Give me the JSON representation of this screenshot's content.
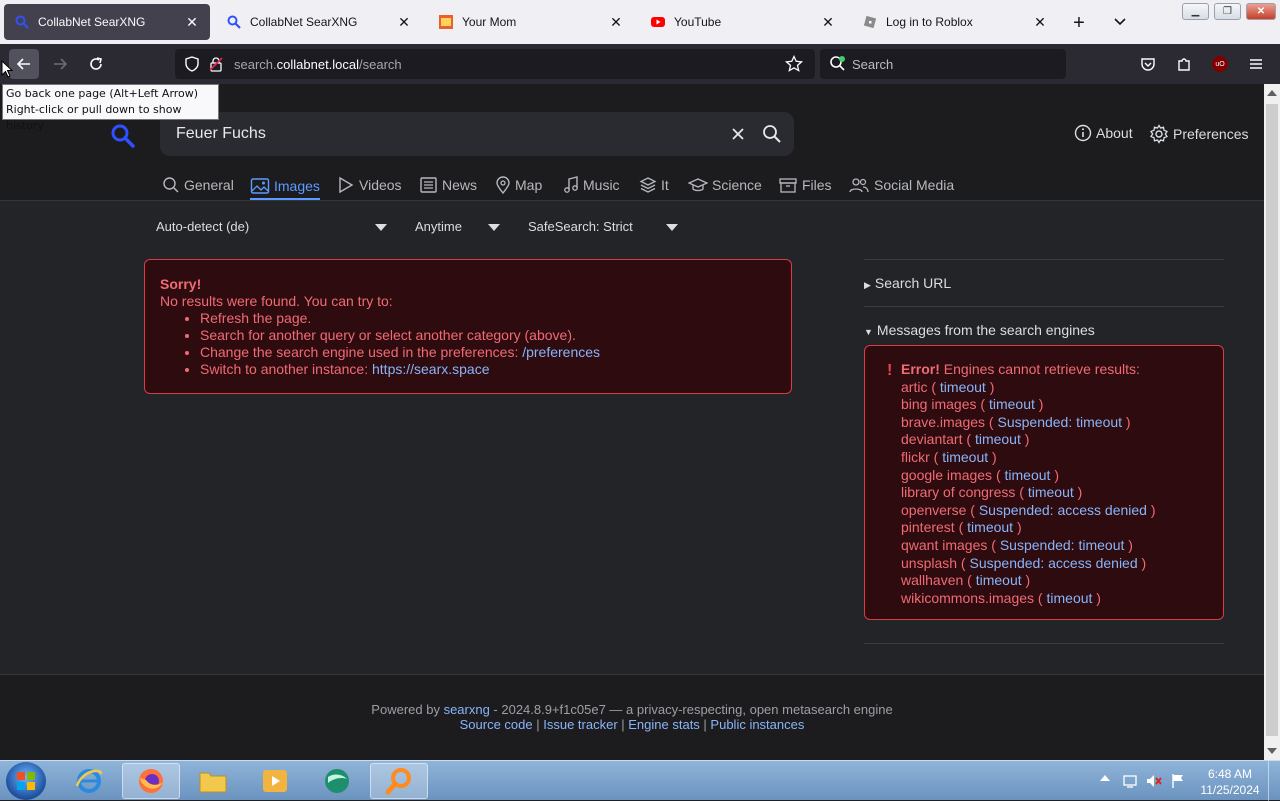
{
  "tabs": [
    {
      "title": "CollabNet SearXNG",
      "active": true,
      "icon": "search-icon"
    },
    {
      "title": "CollabNet SearXNG",
      "active": false,
      "icon": "search-icon"
    },
    {
      "title": "Your Mom",
      "active": false,
      "icon": "image-favicon-icon"
    },
    {
      "title": "YouTube",
      "active": false,
      "icon": "youtube-icon"
    },
    {
      "title": "Log in to Roblox",
      "active": false,
      "icon": "roblox-icon"
    }
  ],
  "url": {
    "prefix": "search.",
    "domain": "collabnet.local",
    "path": "/search"
  },
  "browser_search_placeholder": "Search",
  "tooltip": {
    "line1": "Go back one page (Alt+Left Arrow)",
    "line2": "Right-click or pull down to show history"
  },
  "query": "Feuer Fuchs",
  "header_links": {
    "about": "About",
    "preferences": "Preferences"
  },
  "categories": [
    "General",
    "Images",
    "Videos",
    "News",
    "Map",
    "Music",
    "It",
    "Science",
    "Files",
    "Social Media"
  ],
  "active_category": "Images",
  "filters": {
    "language": "Auto-detect (de)",
    "time": "Anytime",
    "safesearch": "SafeSearch: Strict"
  },
  "sorry": {
    "title": "Sorry!",
    "intro": "No results were found. You can try to:",
    "items": [
      {
        "text": "Refresh the page.",
        "link": ""
      },
      {
        "text": "Search for another query or select another category (above).",
        "link": ""
      },
      {
        "text": "Change the search engine used in the preferences: ",
        "link": "/preferences"
      },
      {
        "text": "Switch to another instance: ",
        "link": "https://searx.space"
      }
    ]
  },
  "sidebar": {
    "search_url": "Search URL",
    "messages_title": "Messages from the search engines",
    "error_label": "Error!",
    "error_text": "Engines cannot retrieve results:",
    "engines": [
      {
        "name": "artic",
        "reason": "timeout"
      },
      {
        "name": "bing images",
        "reason": "timeout"
      },
      {
        "name": "brave.images",
        "reason": "Suspended: timeout"
      },
      {
        "name": "deviantart",
        "reason": "timeout"
      },
      {
        "name": "flickr",
        "reason": "timeout"
      },
      {
        "name": "google images",
        "reason": "timeout"
      },
      {
        "name": "library of congress",
        "reason": "timeout"
      },
      {
        "name": "openverse",
        "reason": "Suspended: access denied"
      },
      {
        "name": "pinterest",
        "reason": "timeout"
      },
      {
        "name": "qwant images",
        "reason": "Suspended: timeout"
      },
      {
        "name": "unsplash",
        "reason": "Suspended: access denied"
      },
      {
        "name": "wallhaven",
        "reason": "timeout"
      },
      {
        "name": "wikicommons.images",
        "reason": "timeout"
      }
    ]
  },
  "footer": {
    "powered_by": "Powered by ",
    "searxng": "searxng",
    "version": " - 2024.8.9+f1c05e7 — a privacy-respecting, open metasearch engine",
    "links": [
      "Source code",
      "Issue tracker",
      "Engine stats",
      "Public instances"
    ]
  },
  "clock": {
    "time": "6:48 AM",
    "date": "11/25/2024"
  },
  "colors": {
    "accent": "#5c9bff",
    "error_text": "#f06b74",
    "error_border": "#d83b46"
  }
}
